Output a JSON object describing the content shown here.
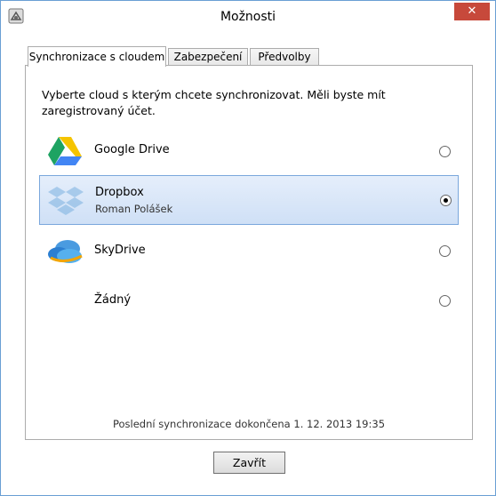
{
  "window": {
    "title": "Možnosti",
    "close_label": "✕"
  },
  "tabs": [
    {
      "label": "Synchronizace s cloudem",
      "active": true
    },
    {
      "label": "Zabezpečení",
      "active": false
    },
    {
      "label": "Předvolby",
      "active": false
    }
  ],
  "intro": "Vyberte cloud s kterým chcete synchronizovat. Měli byste mít zaregistrovaný účet.",
  "providers": [
    {
      "name": "Google Drive",
      "sub": "",
      "icon": "google-drive-icon",
      "selected": false
    },
    {
      "name": "Dropbox",
      "sub": "Roman Polášek",
      "icon": "dropbox-icon",
      "selected": true
    },
    {
      "name": "SkyDrive",
      "sub": "",
      "icon": "skydrive-icon",
      "selected": false
    },
    {
      "name": "Žádný",
      "sub": "",
      "icon": "",
      "selected": false
    }
  ],
  "status": "Poslední synchronizace dokončena  1. 12. 2013 19:35",
  "button": {
    "label": "Zavřít"
  },
  "colors": {
    "accent": "#7aa7dc",
    "close": "#c7493b"
  }
}
